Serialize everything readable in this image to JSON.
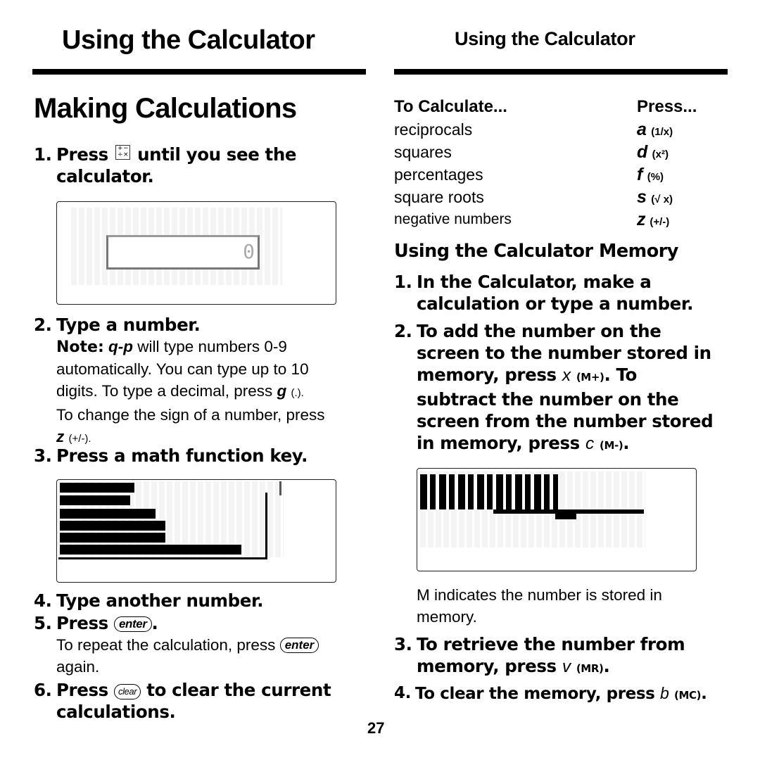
{
  "header": {
    "left_title": "Using the Calculator",
    "right_title": "Using the Calculator"
  },
  "left": {
    "section_title": "Making Calculations",
    "step1": {
      "num": "1.",
      "pre": "Press",
      "icon": "calculator-key-icon",
      "icon_glyphs": [
        "+",
        "−",
        "÷",
        "×"
      ],
      "post": "until you see the calculator."
    },
    "screen1": {
      "display_value": "0"
    },
    "step2": {
      "num": "2.",
      "text": "Type a number.",
      "note_label": "Note:",
      "note_key": "q-p",
      "note_line1": "will type numbers 0-9",
      "note_line2": "automatically. You can type up to 10",
      "note_line3_pre": "digits. To type a decimal, press",
      "note_decimal_key": "g",
      "note_decimal_paren": "(.).",
      "note_line4": "To change the sign of a number, press",
      "note_sign_key": "z",
      "note_sign_paren": "(+/-)."
    },
    "step3": {
      "num": "3.",
      "text": "Press a math function key."
    },
    "step4": {
      "num": "4.",
      "text": "Type another number."
    },
    "step5": {
      "num": "5.",
      "pre": "Press",
      "key": "enter",
      "post": "."
    },
    "step5_note": {
      "pre": "To repeat the calculation, press",
      "key": "enter",
      "post": "again."
    },
    "step6": {
      "num": "6.",
      "pre": "Press",
      "key": "clear",
      "post_line1": "to clear the current",
      "post_line2": "calculations."
    }
  },
  "right": {
    "table": {
      "col1_header": "To Calculate...",
      "col2_header": "Press...",
      "rows": [
        {
          "label": "reciprocals",
          "key": "a",
          "paren": "(1/x)"
        },
        {
          "label": "squares",
          "key": "d",
          "paren": "(x²)"
        },
        {
          "label": "percentages",
          "key": "f",
          "paren": "(%)"
        },
        {
          "label": "square roots",
          "key": "s",
          "paren": "(√ x)"
        },
        {
          "label": "negative numbers",
          "key": "z",
          "paren": "(+/-)"
        }
      ]
    },
    "memory_title": "Using the Calculator Memory",
    "m_step1": {
      "num": "1.",
      "line1": "In the Calculator, make a",
      "line2": "calculation or type a number."
    },
    "m_step2": {
      "num": "2.",
      "line1": "To add the number on the",
      "line2": "screen to the number stored in",
      "line3_pre": "memory, press",
      "key1": "x",
      "paren1": "(M+)",
      "line3_post": ". To",
      "line4": "subtract the number on the",
      "line5": "screen from the number stored",
      "line6_pre": "in memory, press",
      "key2": "c",
      "paren2": "(M-)",
      "line6_post": "."
    },
    "m_note": {
      "line1": "M indicates the number is stored in",
      "line2": "memory."
    },
    "m_step3": {
      "num": "3.",
      "line1": "To retrieve the number from",
      "line2_pre": "memory, press",
      "key": "v",
      "paren": "(MR)",
      "post": "."
    },
    "m_step4": {
      "num": "4.",
      "pre": "To clear the memory, press",
      "key": "b",
      "paren": "(MC)",
      "post": "."
    }
  },
  "footer": {
    "page_number": "27"
  }
}
